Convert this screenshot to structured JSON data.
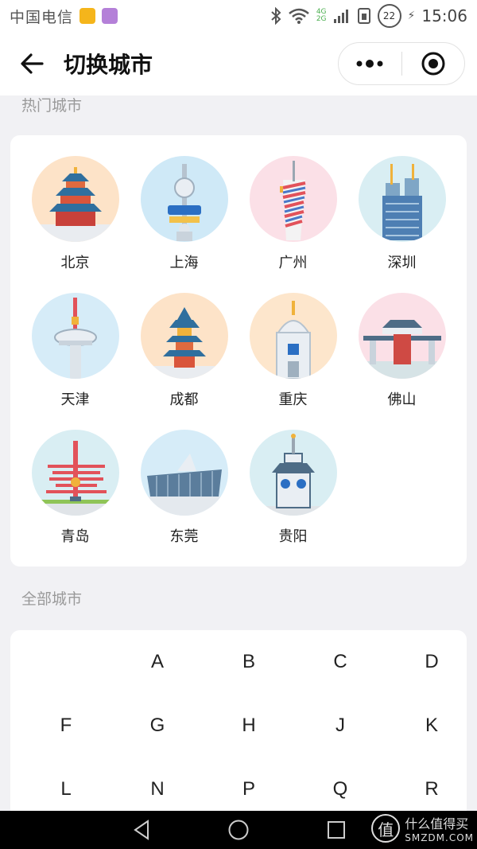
{
  "status_bar": {
    "carrier": "中国电信",
    "network_top": "4G",
    "network_bottom": "2G",
    "battery": "22",
    "time": "15:06"
  },
  "header": {
    "title": "切换城市",
    "back_icon": "arrow-left-icon",
    "menu_icon": "more-dots-icon",
    "close_icon": "target-circle-icon"
  },
  "hot": {
    "label": "热门城市",
    "cities": [
      {
        "name": "北京",
        "bg": "#fde3c8"
      },
      {
        "name": "上海",
        "bg": "#cfe9f7"
      },
      {
        "name": "广州",
        "bg": "#fbe0e7"
      },
      {
        "name": "深圳",
        "bg": "#d9eef3"
      },
      {
        "name": "天津",
        "bg": "#d6ecf8"
      },
      {
        "name": "成都",
        "bg": "#fde3c8"
      },
      {
        "name": "重庆",
        "bg": "#fde6cc"
      },
      {
        "name": "佛山",
        "bg": "#fbe0e7"
      },
      {
        "name": "青岛",
        "bg": "#d9eef3"
      },
      {
        "name": "东莞",
        "bg": "#d6ecf8"
      },
      {
        "name": "贵阳",
        "bg": "#d9eef3"
      }
    ]
  },
  "all": {
    "label": "全部城市",
    "letters": [
      [
        "",
        "A",
        "B",
        "C",
        "D"
      ],
      [
        "F",
        "G",
        "H",
        "J",
        "K"
      ],
      [
        "L",
        "N",
        "P",
        "Q",
        "R"
      ]
    ]
  },
  "watermark": {
    "line1": "什么值得买",
    "line2": "SMZDM.COM",
    "badge": "值"
  }
}
